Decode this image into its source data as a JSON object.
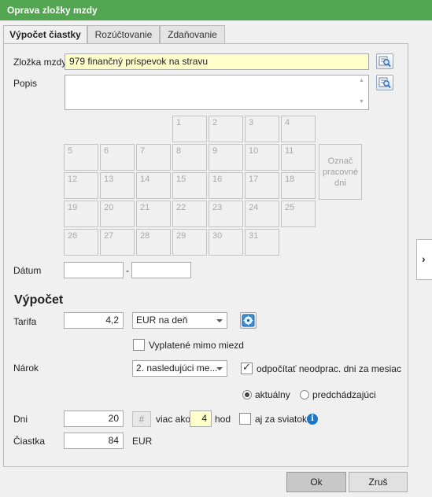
{
  "window": {
    "title": "Oprava zložky mzdy"
  },
  "tabs": [
    {
      "label": "Výpočet čiastky",
      "active": true
    },
    {
      "label": "Rozúčtovanie",
      "active": false
    },
    {
      "label": "Zdaňovanie",
      "active": false
    }
  ],
  "form": {
    "component_label": "Zložka mzdy",
    "component_value": "979  finančný príspevok na stravu",
    "description_label": "Popis",
    "description_value": ""
  },
  "calendar": {
    "days": [
      "1",
      "2",
      "3",
      "4",
      "5",
      "6",
      "7",
      "8",
      "9",
      "10",
      "11",
      "12",
      "13",
      "14",
      "15",
      "16",
      "17",
      "18",
      "19",
      "20",
      "21",
      "22",
      "23",
      "24",
      "25",
      "26",
      "27",
      "28",
      "29",
      "30",
      "31"
    ],
    "mark_button_lines": [
      "Označ",
      "pracovné",
      "dni"
    ]
  },
  "date": {
    "label": "Dátum",
    "from": "",
    "separator": "-",
    "to": ""
  },
  "calculation": {
    "title": "Výpočet",
    "rate_label": "Tarifa",
    "rate_value": "4,2",
    "rate_unit": "EUR na deň",
    "paid_outside_label": "Vyplatené mimo miezd",
    "paid_outside_checked": false,
    "claim_label": "Nárok",
    "claim_value": "2. nasledujúci me...",
    "deduct_label": "odpočítať neodprac. dni za mesiac",
    "deduct_checked": true,
    "radio_current": "aktuálny",
    "radio_previous": "predchádzajúci",
    "radio_selected": "aktuálny",
    "days_label": "Dni",
    "days_value": "20",
    "hash": "#",
    "more_than_label": "viac ako",
    "hours_value": "4",
    "hours_unit": "hod",
    "holiday_label": "aj za sviatok",
    "holiday_checked": false,
    "amount_label": "Čiastka",
    "amount_value": "84",
    "amount_currency": "EUR"
  },
  "buttons": {
    "ok": "Ok",
    "cancel": "Zruš"
  },
  "icons": {
    "lookup": "search-table-icon",
    "calc": "calculator-icon",
    "info": "info-icon",
    "expand": "chevron-right-icon"
  },
  "colors": {
    "titlebar": "#53a651",
    "highlight_field": "#ffffcc",
    "info": "#1a78c8"
  }
}
